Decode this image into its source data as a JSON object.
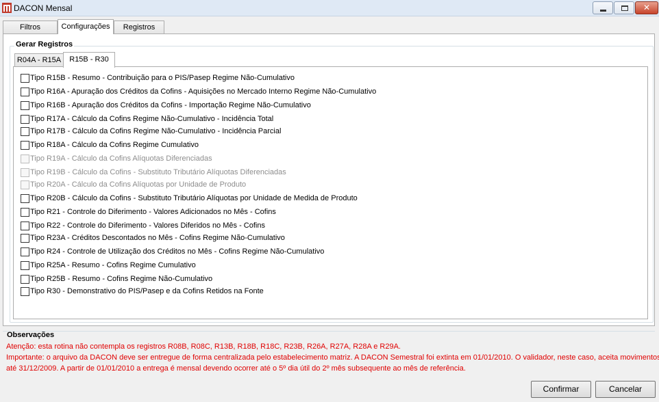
{
  "window": {
    "title": "DACON Mensal",
    "close_glyph": "✕"
  },
  "main_tabs": [
    {
      "label": "Filtros"
    },
    {
      "label": "Configurações"
    },
    {
      "label": "Registros"
    }
  ],
  "group": {
    "title": "Gerar Registros",
    "inner_tabs": [
      {
        "label": "R04A - R15A"
      },
      {
        "label": "R15B - R30"
      }
    ],
    "checkboxes": [
      {
        "label": "Tipo R15B - Resumo - Contribuição para o PIS/Pasep Regime Não-Cumulativo",
        "checked": false,
        "enabled": true
      },
      {
        "label": "Tipo R16A - Apuração dos Créditos da Cofins - Aquisições no Mercado Interno Regime Não-Cumulativo",
        "checked": false,
        "enabled": true
      },
      {
        "label": "Tipo R16B - Apuração dos Créditos da Cofins - Importação Regime Não-Cumulativo",
        "checked": false,
        "enabled": true
      },
      {
        "label": "Tipo R17A - Cálculo da Cofins Regime Não-Cumulativo - Incidência Total",
        "checked": false,
        "enabled": true
      },
      {
        "label": "Tipo R17B - Cálculo da Cofins Regime Não-Cumulativo - Incidência Parcial",
        "checked": false,
        "enabled": true
      },
      {
        "label": "Tipo R18A - Cálculo da Cofins Regime Cumulativo",
        "checked": false,
        "enabled": true
      },
      {
        "label": "Tipo R19A - Cálculo da Cofins Alíquotas Diferenciadas",
        "checked": false,
        "enabled": false
      },
      {
        "label": "Tipo R19B - Cálculo da Cofins - Substituto Tributário Alíquotas Diferenciadas",
        "checked": false,
        "enabled": false
      },
      {
        "label": "Tipo R20A - Cálculo da Cofins Alíquotas por Unidade de Produto",
        "checked": false,
        "enabled": false
      },
      {
        "label": "Tipo R20B - Cálculo da Cofins - Substituto Tributário Alíquotas por Unidade de Medida de Produto",
        "checked": false,
        "enabled": true
      },
      {
        "label": "Tipo R21 - Controle do Diferimento - Valores Adicionados no Mês - Cofins",
        "checked": false,
        "enabled": true
      },
      {
        "label": "Tipo R22 - Controle do Diferimento - Valores Diferidos no Mês - Cofins",
        "checked": false,
        "enabled": true
      },
      {
        "label": "Tipo R23A - Créditos Descontados no Mês - Cofins Regime Não-Cumulativo",
        "checked": false,
        "enabled": true
      },
      {
        "label": "Tipo R24 - Controle de Utilização dos Créditos no Mês - Cofins Regime Não-Cumulativo",
        "checked": false,
        "enabled": true
      },
      {
        "label": "Tipo R25A - Resumo - Cofins Regime Cumulativo",
        "checked": false,
        "enabled": true
      },
      {
        "label": "Tipo R25B - Resumo - Cofins Regime Não-Cumulativo",
        "checked": false,
        "enabled": true
      },
      {
        "label": "Tipo R30 - Demonstrativo do PIS/Pasep e da Cofins Retidos na Fonte",
        "checked": false,
        "enabled": true
      }
    ]
  },
  "observacoes": {
    "title": "Observações",
    "lines": [
      "Atenção: esta rotina não contempla os registros R08B, R08C, R13B, R18B, R18C, R23B, R26A, R27A, R28A e R29A.",
      "Importante: o arquivo da DACON deve ser entregue de forma centralizada pelo estabelecimento matriz. A DACON Semestral foi extinta em 01/01/2010. O validador, neste caso, aceita movimentos",
      "até 31/12/2009. A partir de 01/01/2010 a entrega é mensal devendo ocorrer até o 5º dia útil do 2º mês subsequente ao mês de referência."
    ],
    "color": "#e00000"
  },
  "buttons": {
    "confirm": "Confirmar",
    "cancel": "Cancelar"
  }
}
